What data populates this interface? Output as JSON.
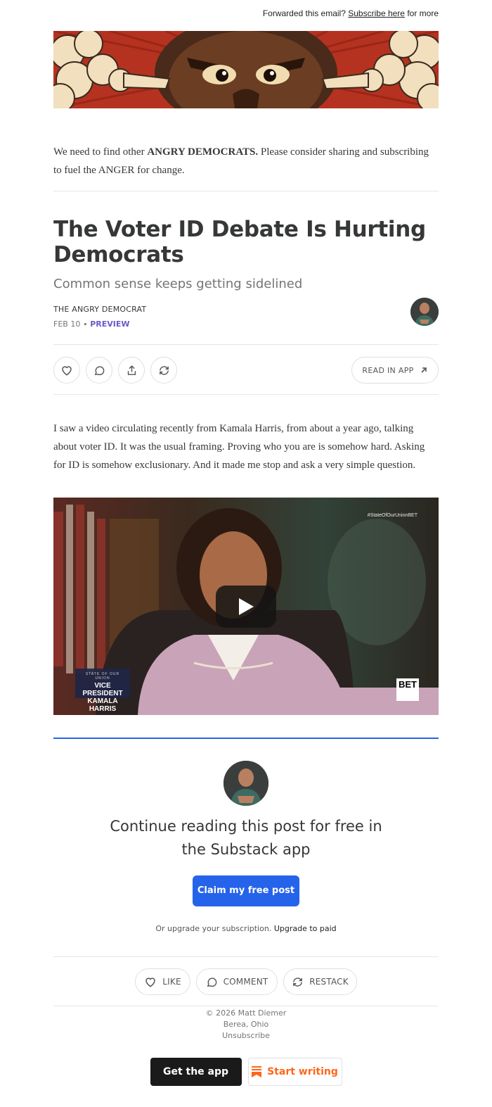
{
  "forward": {
    "prefix": "Forwarded this email?",
    "link": "Subscribe here",
    "suffix": "for more"
  },
  "intro": {
    "before": "We need to find other",
    "bold": "ANGRY DEMOCRATS.",
    "after": "Please consider sharing and subscribing to fuel the ANGER for change."
  },
  "post": {
    "title": "The Voter ID Debate Is Hurting Democrats",
    "subtitle": "Common sense keeps getting sidelined",
    "author": "THE ANGRY DEMOCRAT",
    "date": "FEB 10",
    "dot": "∙",
    "access": "PREVIEW",
    "read_in_app": "READ IN APP",
    "body": "I saw a video circulating recently from Kamala Harris, from about a year ago, talking about voter ID. It was the usual framing. Proving who you are is somehow hard. Asking for ID is somehow exclusionary. And it made me stop and ask a very simple question."
  },
  "video": {
    "hashtag": "#StateOfOurUnionBET",
    "lower_third_top": "STATE OF OUR UNION",
    "lower_third_name": "VICE PRESIDENT KAMALA HARRIS",
    "logo_text": "BET"
  },
  "paywall": {
    "title": "Continue reading this post for free in the Substack app",
    "claim": "Claim my free post",
    "upgrade_prefix": "Or upgrade your subscription.",
    "upgrade_link": "Upgrade to paid"
  },
  "engagement": {
    "like": "LIKE",
    "comment": "COMMENT",
    "restack": "RESTACK"
  },
  "footer": {
    "copyright": "© 2026 Matt Diemer",
    "location": "Berea, Ohio",
    "unsubscribe": "Unsubscribe",
    "get_app": "Get the app",
    "start_writing": "Start writing"
  },
  "colors": {
    "accent_blue": "#2563eb",
    "preview_purple": "#6a5ac9",
    "substack_orange": "#ff6719"
  }
}
